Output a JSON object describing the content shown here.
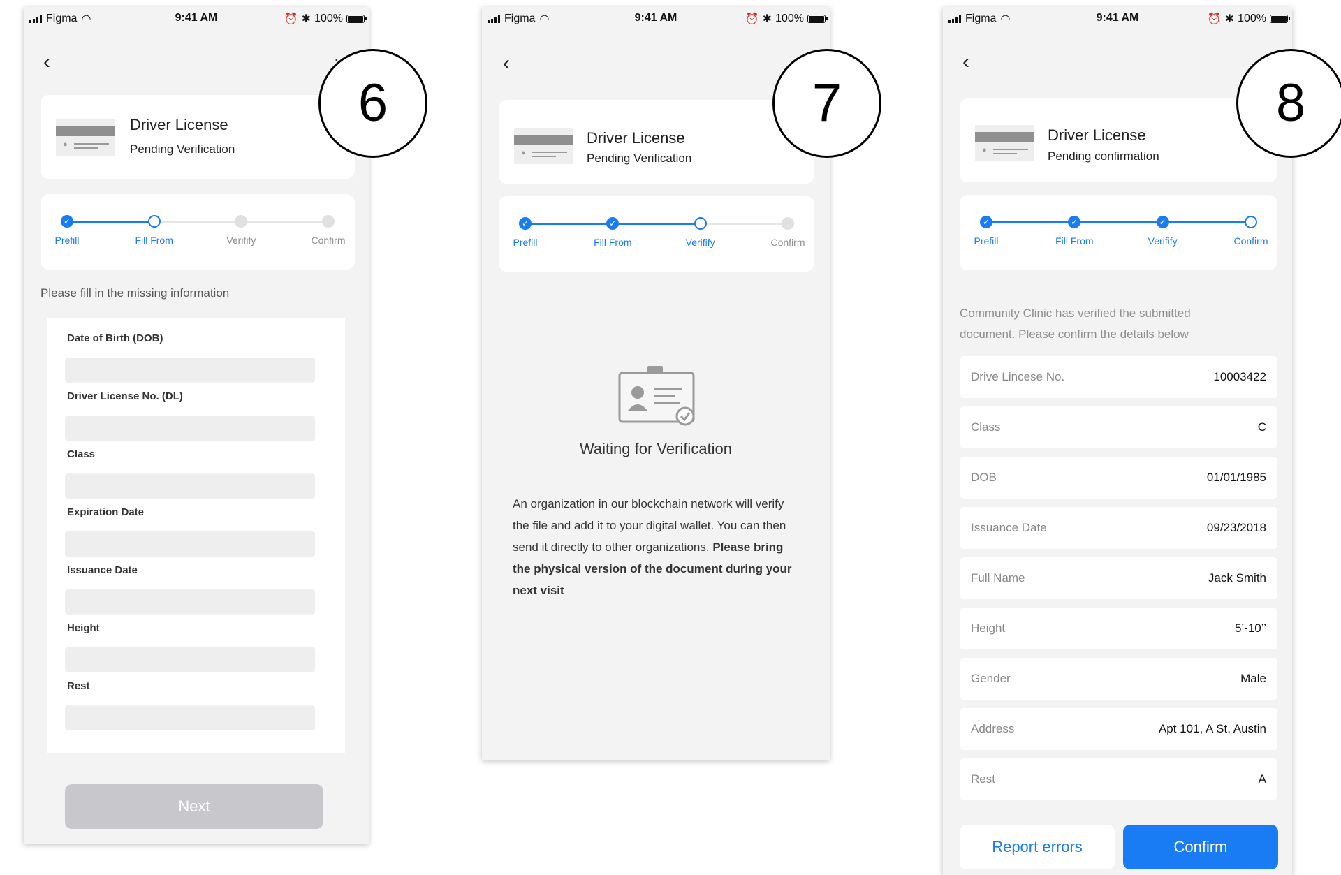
{
  "status_bar": {
    "carrier": "Figma",
    "time": "9:41 AM",
    "battery": "100%"
  },
  "colors": {
    "accent": "#1a7cf5",
    "track_inactive": "#e5e5e5",
    "button_disabled": "#c8c8cc"
  },
  "icons": [
    "back-chevron-icon",
    "more-icon",
    "signal-icon",
    "wifi-icon",
    "alarm-icon",
    "bluetooth-icon",
    "battery-icon",
    "check-icon",
    "id-card-icon"
  ],
  "steps": [
    "Prefill",
    "Fill From",
    "Verifify",
    "Confirm"
  ],
  "screen6": {
    "badge": "6",
    "doc_title": "Driver License",
    "doc_status": "Pending Verification",
    "step_states": [
      "done",
      "current",
      "todo",
      "todo"
    ],
    "instruction": "Please fill in the missing information",
    "fields": [
      {
        "label": "Date of Birth (DOB)",
        "value": ""
      },
      {
        "label": "Driver License No. (DL)",
        "value": ""
      },
      {
        "label": "Class",
        "value": ""
      },
      {
        "label": "Expiration Date",
        "value": ""
      },
      {
        "label": "Issuance Date",
        "value": ""
      },
      {
        "label": "Height",
        "value": ""
      },
      {
        "label": "Rest",
        "value": ""
      }
    ],
    "next_button": "Next"
  },
  "screen7": {
    "badge": "7",
    "doc_title": "Driver License",
    "doc_status": "Pending Verification",
    "step_states": [
      "done",
      "done",
      "current",
      "todo"
    ],
    "waiting_title": "Waiting for Verification",
    "body_regular": "An organization in our blockchain network will verify the file and add it to your digital wallet. You can then send it directly to other organizations.",
    "body_bold": "Please bring the physical version of the document during your next visit"
  },
  "screen8": {
    "badge": "8",
    "doc_title": "Driver License",
    "doc_status": "Pending confirmation",
    "step_states": [
      "done",
      "done",
      "done",
      "current"
    ],
    "intro": "Community Clinic has verified the submitted document. Please confirm the details below",
    "details": [
      {
        "key": "Drive Lincese No.",
        "value": "10003422"
      },
      {
        "key": "Class",
        "value": "C"
      },
      {
        "key": "DOB",
        "value": "01/01/1985"
      },
      {
        "key": "Issuance Date",
        "value": "09/23/2018"
      },
      {
        "key": "Full Name",
        "value": "Jack Smith"
      },
      {
        "key": "Height",
        "value": "5’-10’’"
      },
      {
        "key": "Gender",
        "value": "Male"
      },
      {
        "key": "Address",
        "value": "Apt 101, A St, Austin"
      },
      {
        "key": "Rest",
        "value": "A"
      }
    ],
    "report_button": "Report errors",
    "confirm_button": "Confirm"
  }
}
